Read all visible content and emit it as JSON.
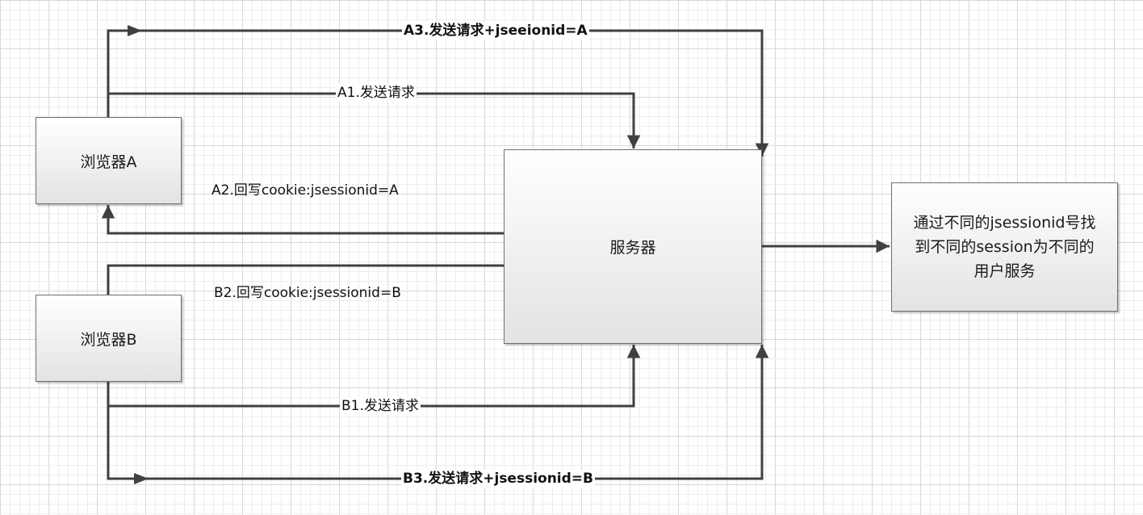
{
  "nodes": {
    "browser_a": "浏览器A",
    "browser_b": "浏览器B",
    "server": "服务器",
    "note_lines": [
      "通过不同的jsessionid号找",
      "到不同的session为不同的",
      "用户服务"
    ]
  },
  "edges": {
    "a1": "A1.发送请求",
    "a2": "A2.回写cookie:jsessionid=A",
    "a3": "A3.发送请求+jseeionid=A",
    "b1": "B1.发送请求",
    "b2": "B2.回写cookie:jsessionid=B",
    "b3": "B3.发送请求+jsessionid=B"
  },
  "colors": {
    "grid_minor": "#eeeeee",
    "grid_major": "#d8d8d8",
    "line": "#404040"
  }
}
